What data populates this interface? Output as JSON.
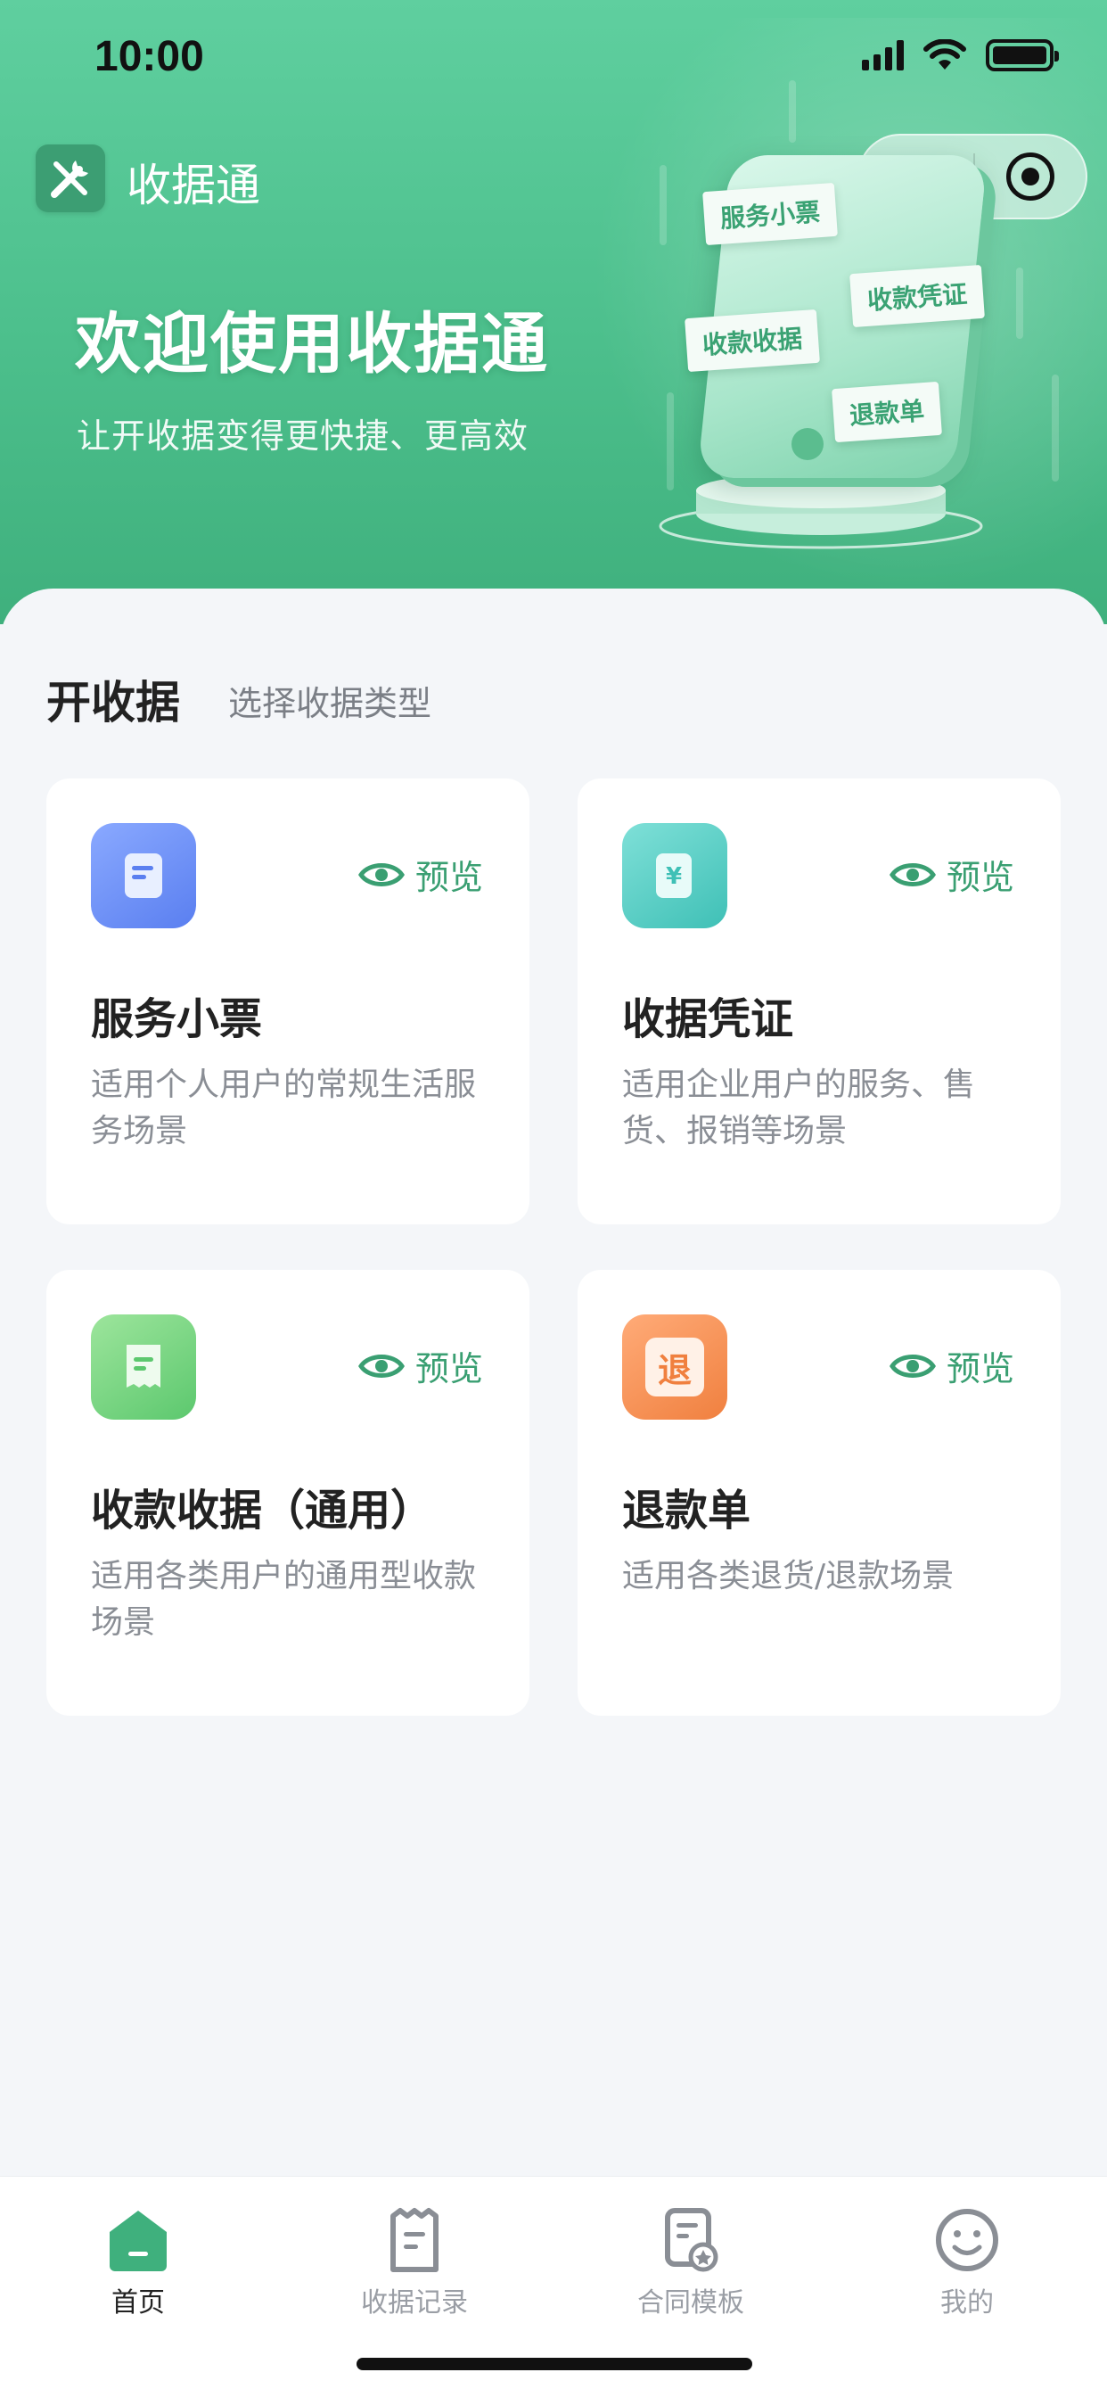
{
  "status_bar": {
    "time": "10:00"
  },
  "header": {
    "app_name": "收据通",
    "hero_title": "欢迎使用收据通",
    "hero_subtitle": "让开收据变得更快捷、更高效",
    "illustration_tags": [
      "服务小票",
      "收款凭证",
      "收款收据",
      "退款单"
    ]
  },
  "section": {
    "title": "开收据",
    "subtitle": "选择收据类型"
  },
  "cards": [
    {
      "title": "服务小票",
      "desc": "适用个人用户的常规生活服务场景",
      "preview": "预览",
      "icon": "receipt-icon",
      "color": "#5a86f0"
    },
    {
      "title": "收据凭证",
      "desc": "适用企业用户的服务、售货、报销等场景",
      "preview": "预览",
      "icon": "yuan-document-icon",
      "color": "#4cc7c0"
    },
    {
      "title": "收款收据（通用）",
      "desc": "适用各类用户的通用型收款场景",
      "preview": "预览",
      "icon": "receipt-paper-icon",
      "color": "#6fd07a"
    },
    {
      "title": "退款单",
      "desc": "适用各类退货/退款场景",
      "preview": "预览",
      "icon": "refund-icon",
      "icon_text": "退",
      "color": "#f3874a"
    }
  ],
  "tabbar": {
    "items": [
      {
        "label": "首页",
        "icon": "home-icon",
        "active": true
      },
      {
        "label": "收据记录",
        "icon": "records-icon",
        "active": false
      },
      {
        "label": "合同模板",
        "icon": "contract-template-icon",
        "active": false
      },
      {
        "label": "我的",
        "icon": "profile-icon",
        "active": false
      }
    ]
  },
  "colors": {
    "brand": "#4cbf8c",
    "accent_text": "#3a9f72"
  }
}
